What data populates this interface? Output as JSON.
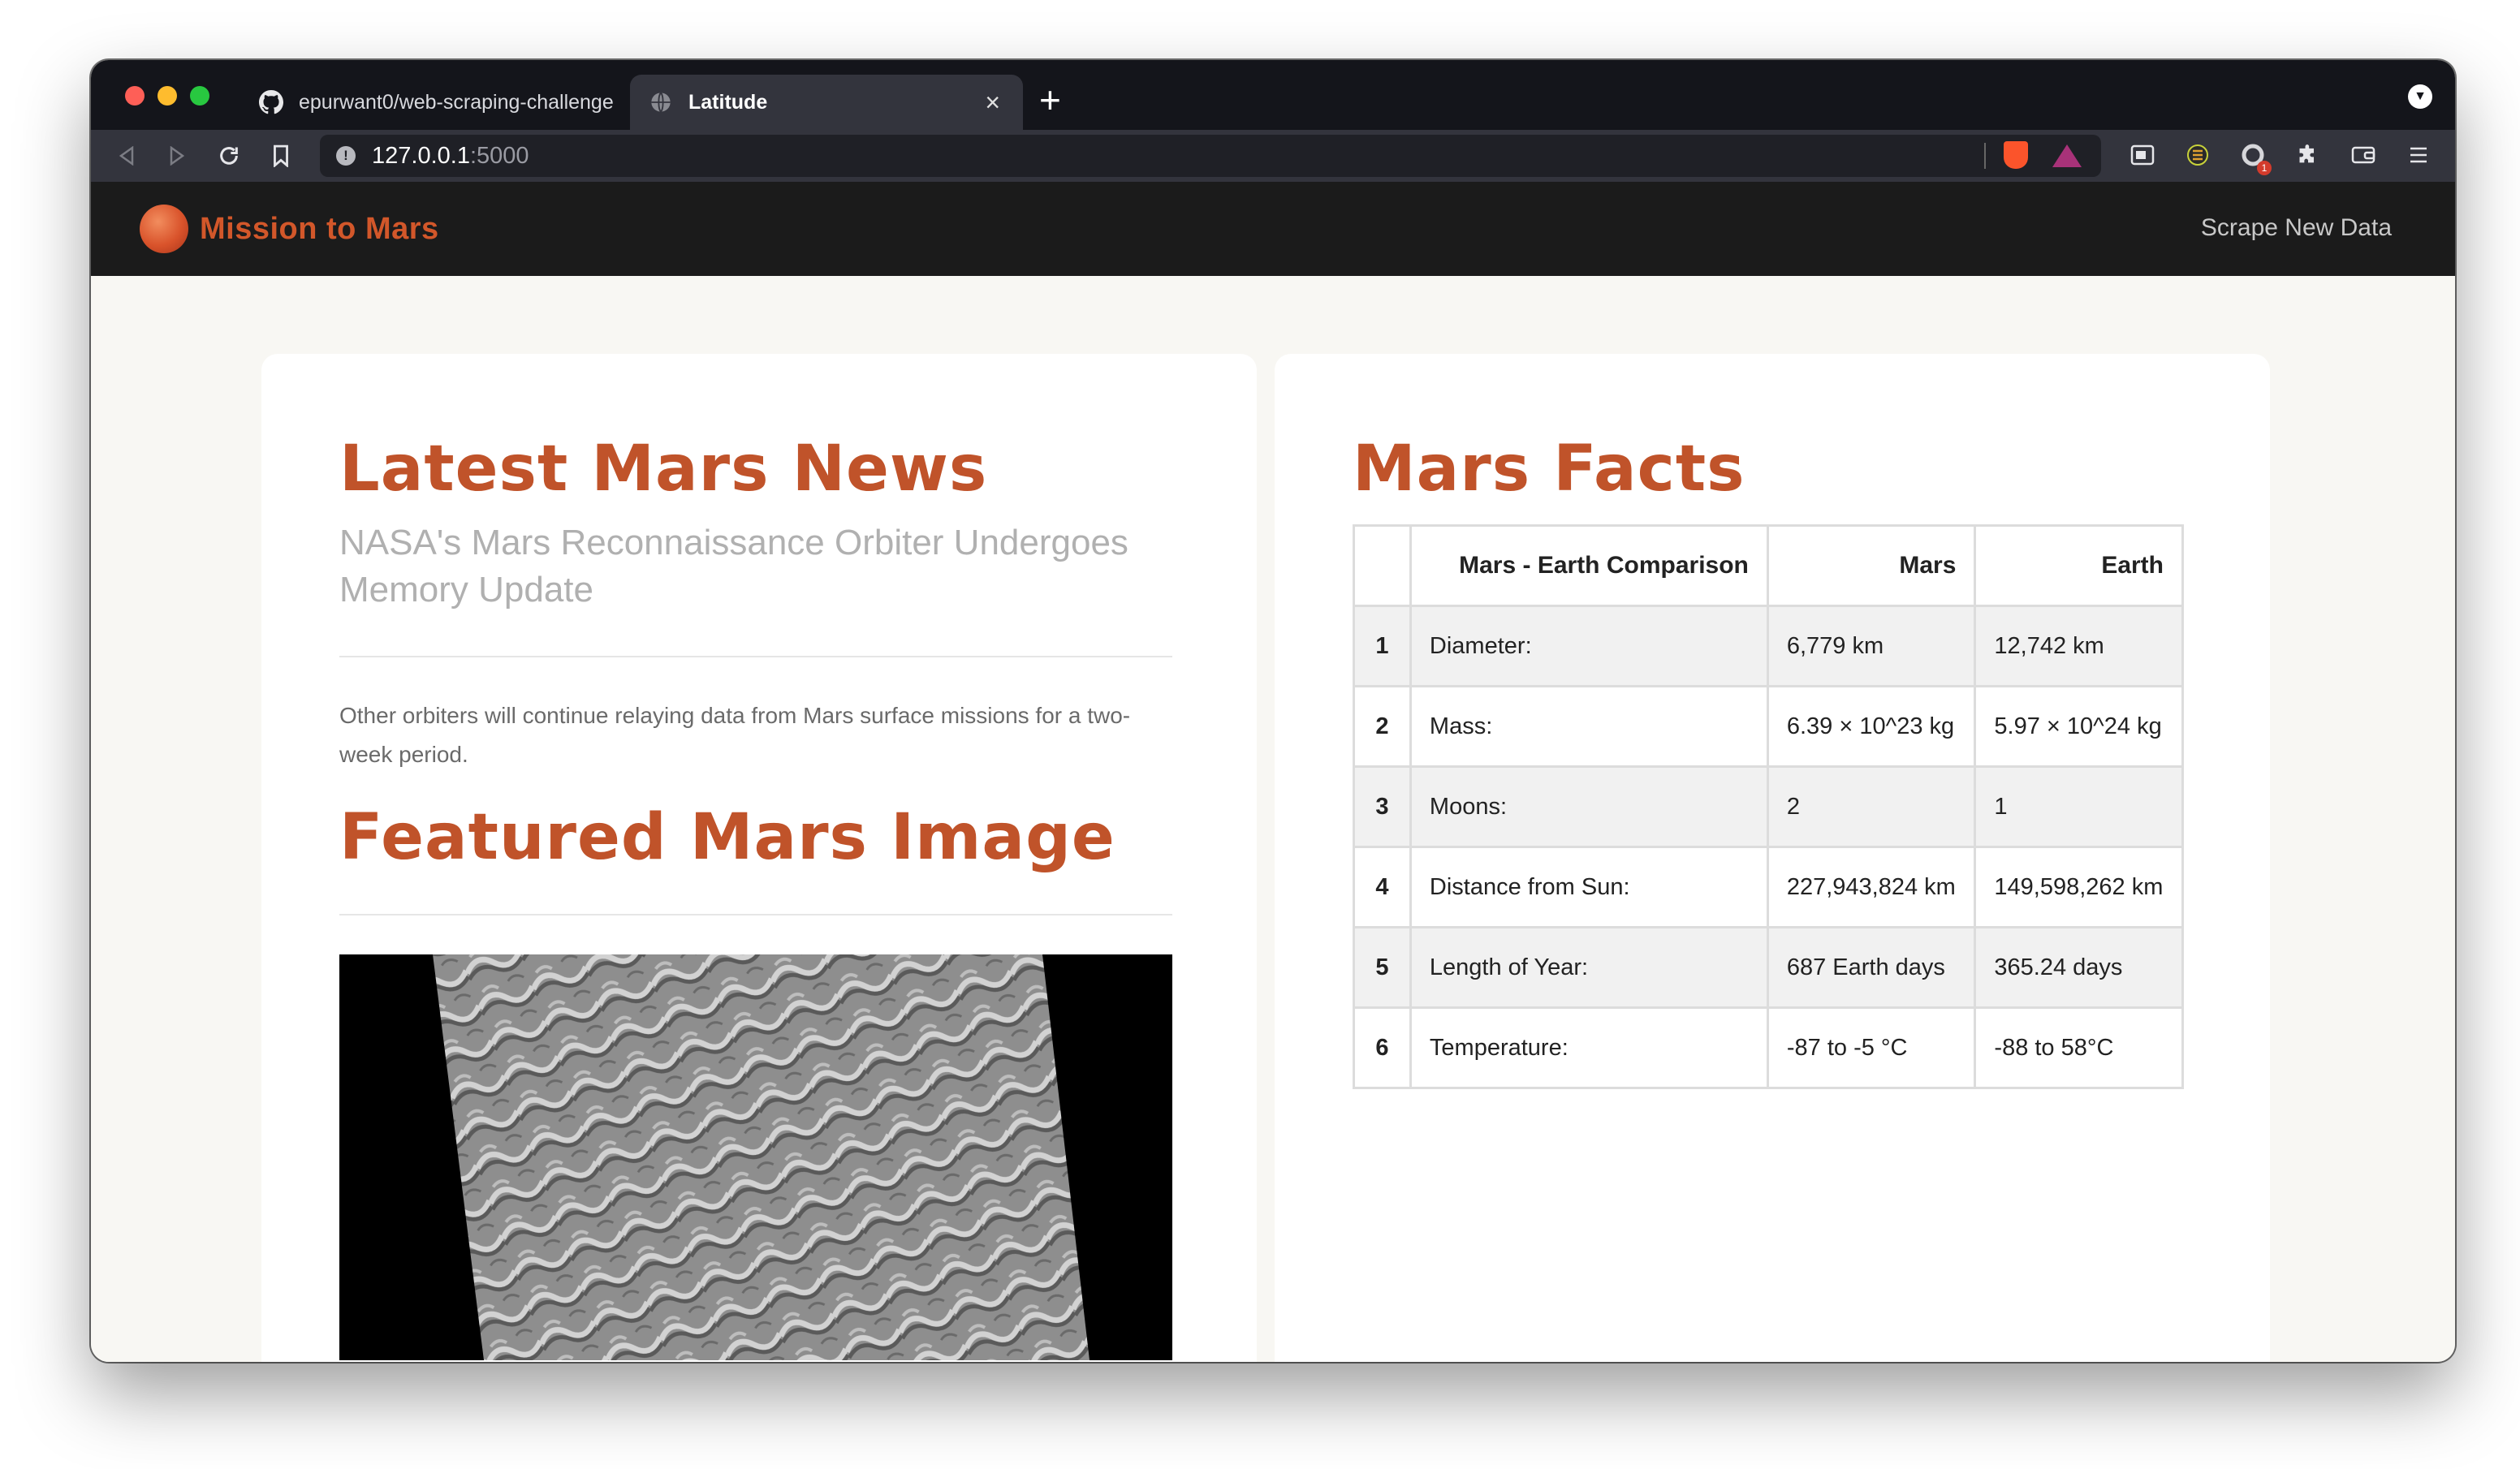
{
  "browser": {
    "tabs": [
      {
        "label": "epurwant0/web-scraping-challenge",
        "icon": "github-icon"
      },
      {
        "label": "Latitude",
        "icon": "globe-icon"
      }
    ],
    "url": {
      "host": "127.0.0.1",
      "port": ":5000"
    }
  },
  "navbar": {
    "brand": "Mission to Mars",
    "scrape_link": "Scrape New Data"
  },
  "news": {
    "section_title": "Latest Mars News",
    "headline": "NASA's Mars Reconnaissance Orbiter Undergoes Memory Update",
    "teaser": "Other orbiters will continue relaying data from Mars surface missions for a two-week period."
  },
  "featured": {
    "section_title": "Featured Mars Image"
  },
  "facts": {
    "section_title": "Mars Facts",
    "headers": [
      "",
      "Mars - Earth Comparison",
      "Mars",
      "Earth"
    ],
    "rows": [
      {
        "idx": "1",
        "desc": "Diameter:",
        "mars": "6,779 km",
        "earth": "12,742 km"
      },
      {
        "idx": "2",
        "desc": "Mass:",
        "mars": "6.39 × 10^23 kg",
        "earth": "5.97 × 10^24 kg"
      },
      {
        "idx": "3",
        "desc": "Moons:",
        "mars": "2",
        "earth": "1"
      },
      {
        "idx": "4",
        "desc": "Distance from Sun:",
        "mars": "227,943,824 km",
        "earth": "149,598,262 km"
      },
      {
        "idx": "5",
        "desc": "Length of Year:",
        "mars": "687 Earth days",
        "earth": "365.24 days"
      },
      {
        "idx": "6",
        "desc": "Temperature:",
        "mars": "-87 to -5 °C",
        "earth": "-88 to 58°C"
      }
    ]
  },
  "colors": {
    "accent": "#c0532a",
    "navbar": "#1b1b1b",
    "page_bg": "#f8f7f3"
  }
}
